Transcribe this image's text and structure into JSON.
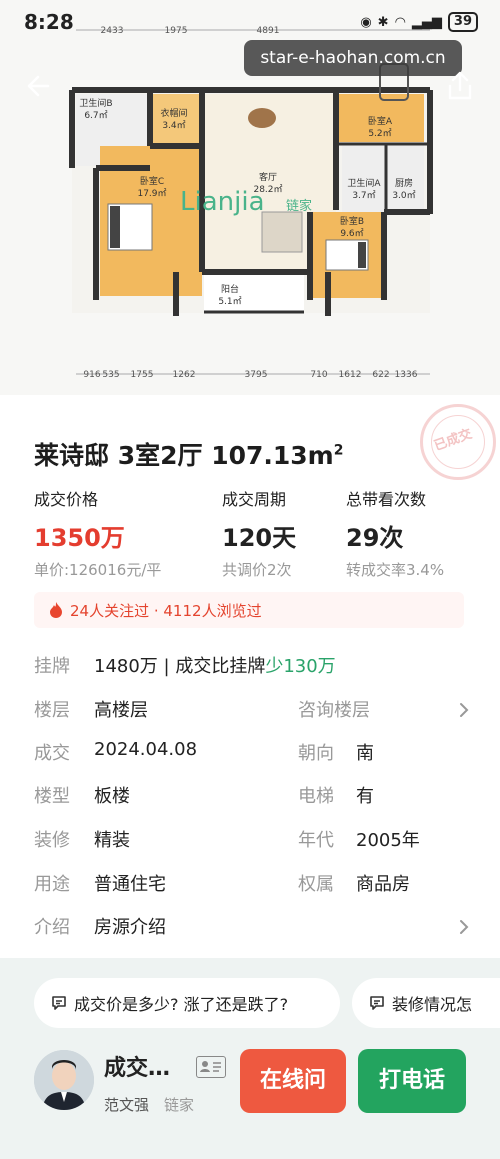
{
  "status_bar": {
    "time": "8:28",
    "battery": "39"
  },
  "watermark": "star-e-haohan.com.cn",
  "floor_plan": {
    "brand": "Lianjia",
    "brand_tag": "链家",
    "top_dimensions": [
      "2433",
      "1975",
      "4891"
    ],
    "bottom_dimensions": [
      "916",
      "535",
      "1755",
      "1262",
      "3795",
      "710",
      "1612",
      "622",
      "1336"
    ],
    "rooms": [
      {
        "name": "卫生间B",
        "area": "6.7㎡"
      },
      {
        "name": "衣帽间",
        "area": "3.4㎡"
      },
      {
        "name": "卧室C",
        "area": "17.9㎡"
      },
      {
        "name": "客厅",
        "area": "28.2㎡"
      },
      {
        "name": "卧室A",
        "area": "5.2㎡"
      },
      {
        "name": "卫生间A",
        "area": "3.7㎡"
      },
      {
        "name": "厨房",
        "area": "3.0㎡"
      },
      {
        "name": "卧室B",
        "area": "9.6㎡"
      },
      {
        "name": "阳台",
        "area": "5.1㎡"
      }
    ]
  },
  "listing": {
    "stamp": "已成交",
    "title": "莱诗邸 3室2厅 107.13m",
    "title_sup": "2",
    "metrics": [
      {
        "label": "成交价格",
        "value": "1350万",
        "sub": "单价:126016元/平"
      },
      {
        "label": "成交周期",
        "value": "120天",
        "sub": "共调价2次"
      },
      {
        "label": "总带看次数",
        "value": "29次",
        "sub": "转成交率3.4%"
      }
    ],
    "attention": "24人关注过 · 4112人浏览过",
    "rows": [
      {
        "k": "挂牌",
        "v": "1480万 | 成交比挂牌",
        "v_green": "少130万"
      },
      {
        "k": "楼层",
        "v": "高楼层",
        "v2_green": "咨询楼层"
      },
      {
        "k": "成交",
        "v": "2024.04.08",
        "k2": "朝向",
        "v2": "南"
      },
      {
        "k": "楼型",
        "v": "板楼",
        "k2": "电梯",
        "v2": "有"
      },
      {
        "k": "装修",
        "v": "精装",
        "k2": "年代",
        "v2": "2005年"
      },
      {
        "k": "用途",
        "v": "普通住宅",
        "k2": "权属",
        "v2": "商品房"
      },
      {
        "k": "介绍",
        "v": "房源介绍"
      }
    ]
  },
  "questions": [
    "成交价是多少? 涨了还是跌了?",
    "装修情况怎"
  ],
  "agent": {
    "title": "成交…",
    "name": "范文强",
    "company": "链家",
    "btn_online": "在线问",
    "btn_call": "打电话"
  }
}
